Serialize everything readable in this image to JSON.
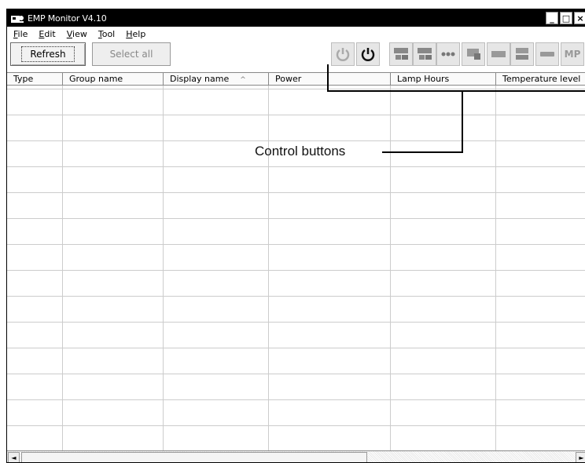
{
  "window": {
    "title": "EMP Monitor V4.10",
    "controls": {
      "minimize": "_",
      "maximize": "□",
      "close": "×"
    }
  },
  "menu": {
    "items": [
      {
        "label": "File",
        "key": "F",
        "rest": "ile"
      },
      {
        "label": "Edit",
        "key": "E",
        "rest": "dit"
      },
      {
        "label": "View",
        "key": "V",
        "rest": "iew"
      },
      {
        "label": "Tool",
        "key": "T",
        "rest": "ool"
      },
      {
        "label": "Help",
        "key": "H",
        "rest": "elp"
      }
    ]
  },
  "toolbar": {
    "refresh_label": "Refresh",
    "select_all_label": "Select all",
    "icons": [
      "power-on-icon",
      "power-off-icon",
      "computer1-source-icon",
      "computer2-source-icon",
      "video-source-icon",
      "svideo-source-icon",
      "a-v-mute-icon",
      "display-source-icon",
      "freeze-icon",
      "mp-icon"
    ],
    "mp_label": "MP"
  },
  "table": {
    "columns": [
      {
        "label": "Type"
      },
      {
        "label": "Group name"
      },
      {
        "label": "Display name",
        "sort": "^"
      },
      {
        "label": "Power"
      },
      {
        "label": "Lamp Hours"
      },
      {
        "label": "Temperature level"
      }
    ],
    "rows": []
  },
  "annotation": {
    "label": "Control buttons"
  },
  "scrollbar": {
    "left_arrow": "◄",
    "right_arrow": "►"
  }
}
